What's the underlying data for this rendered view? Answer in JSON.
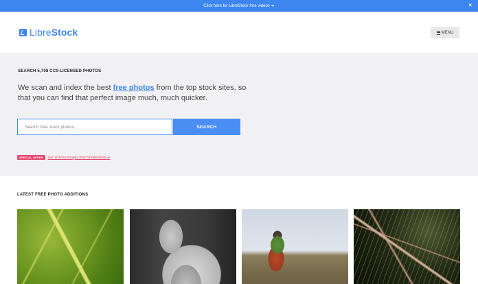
{
  "topbar": {
    "text": "Click here for LibreStock free videos",
    "arrow": "➔",
    "close": "×"
  },
  "header": {
    "logo": {
      "light": "Libre",
      "bold": "Stock"
    },
    "menu_label": "MENU"
  },
  "hero": {
    "label": "SEARCH 5,708 CC0-LICENSED PHOTOS",
    "text_before": "We scan and index the best ",
    "text_link": "free photos",
    "text_after": " from the top stock sites, so that you can find that perfect image much, much quicker."
  },
  "search": {
    "placeholder": "Search free stock photos...",
    "button_label": "SEARCH"
  },
  "offer": {
    "badge": "SPECIAL OFFER",
    "link": "Get 10 Free Images from Shutterstock ➔"
  },
  "latest": {
    "label": "LATEST FREE PHOTO ADDITIONS",
    "photos": [
      "leaf",
      "jeans",
      "hiker",
      "grass"
    ]
  },
  "colors": {
    "accent": "#3d86f0",
    "offer": "#e8476e",
    "hero_bg": "#f1f1f3"
  }
}
